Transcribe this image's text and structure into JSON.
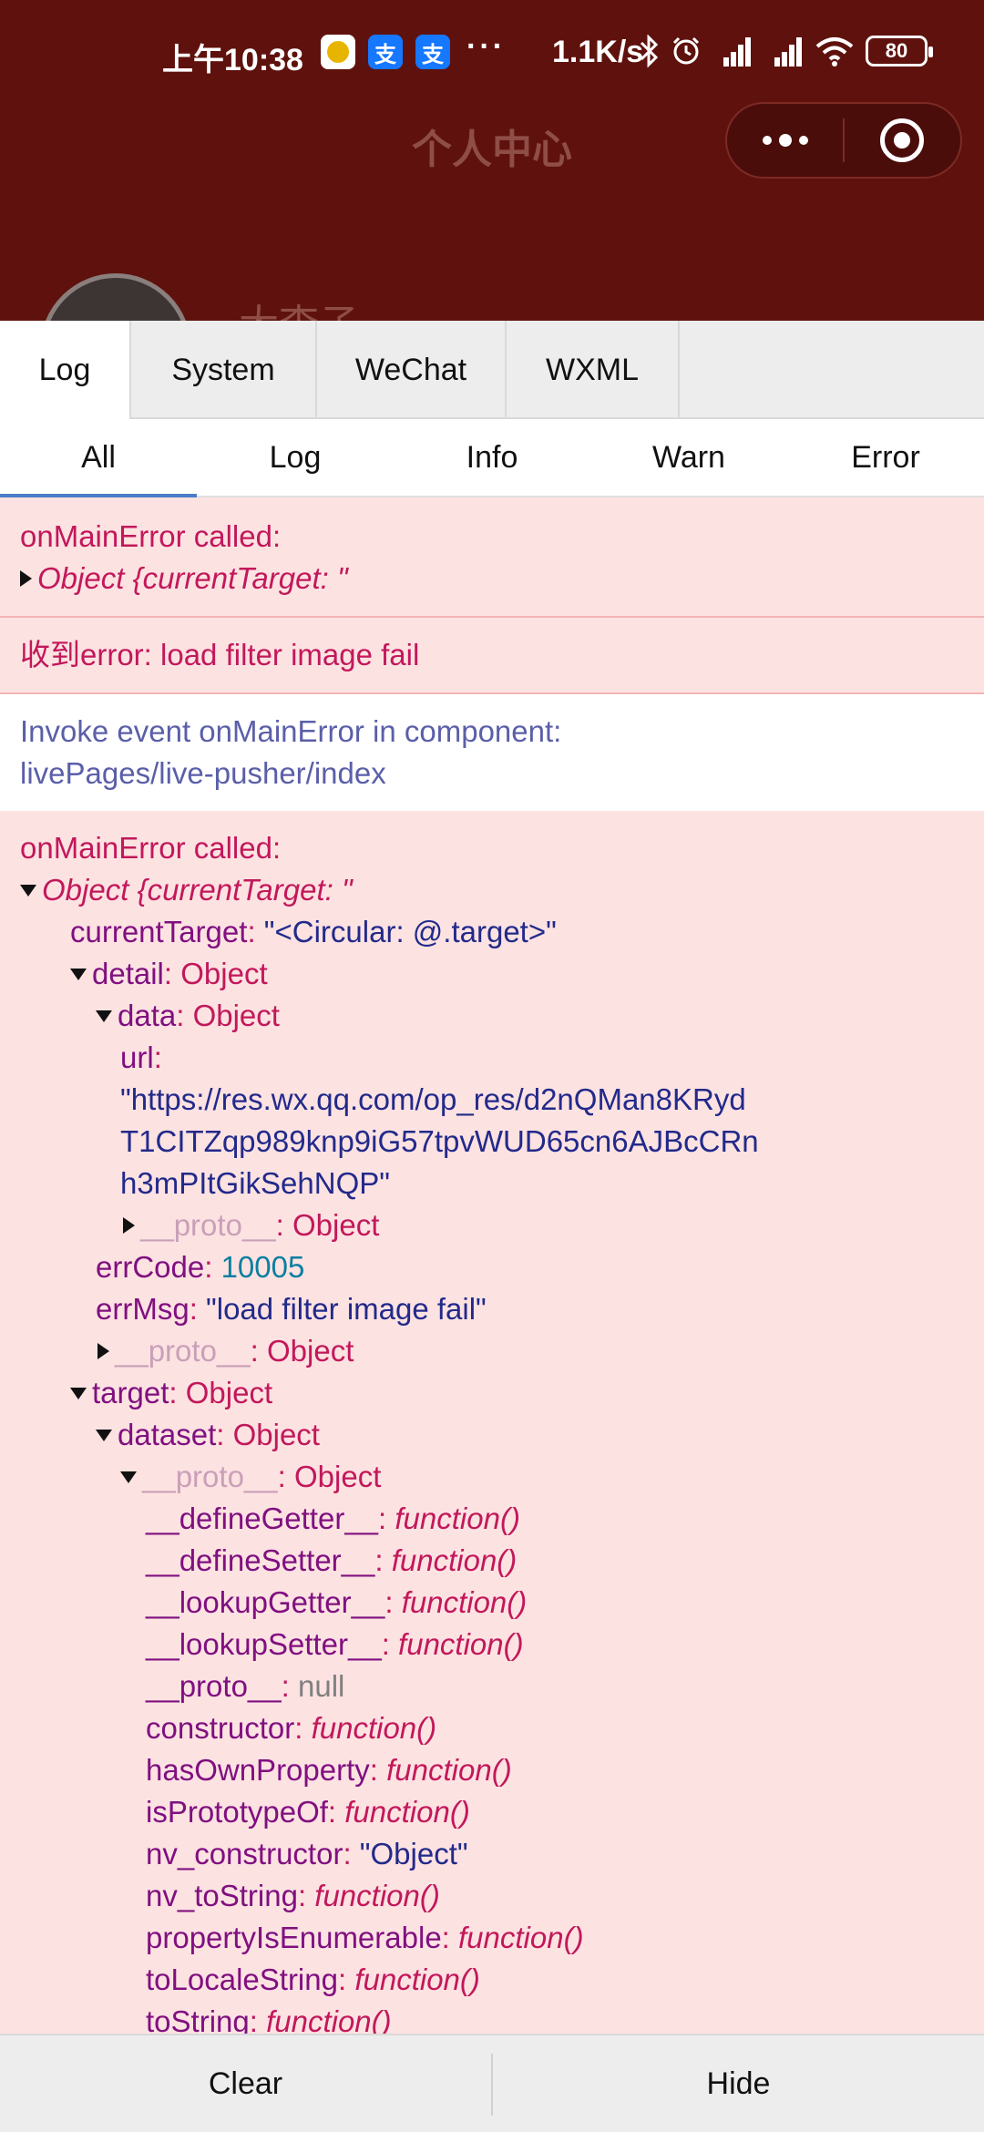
{
  "status_bar": {
    "time": "上午10:38",
    "alipay_glyph": "支",
    "more": "···",
    "net_speed": "1.1K/s",
    "battery": "80",
    "icons": [
      "lemon-app-icon",
      "alipay-icon",
      "alipay-icon",
      "bluetooth-icon",
      "alarm-icon",
      "signal-hd-icon",
      "signal-hd-icon",
      "wifi-icon",
      "battery-icon"
    ]
  },
  "header": {
    "title": "个人中心",
    "user_name": "大李子"
  },
  "console": {
    "main_tabs": [
      "Log",
      "System",
      "WeChat",
      "WXML"
    ],
    "filter_tabs": [
      "All",
      "Log",
      "Info",
      "Warn",
      "Error"
    ],
    "entry1": {
      "line1": "onMainError called:",
      "obj": "Object {currentTarget: \""
    },
    "entry2": {
      "text": "收到error: load filter image fail"
    },
    "entry3": {
      "line1": "Invoke event onMainError in component:",
      "line2": "livePages/live-pusher/index"
    },
    "entry4": {
      "line1": "onMainError called:",
      "obj": "Object {currentTarget: \"",
      "currentTarget_key": "currentTarget",
      "currentTarget_val": "\"<Circular: @.target>\"",
      "detail_key": "detail",
      "data_key": "data",
      "url_key": "url",
      "url_val_1": "\"https://res.wx.qq.com/op_res/d2nQMan8KRyd",
      "url_val_2": "T1CITZqp989knp9iG57tpvWUD65cn6AJBcCRn",
      "url_val_3": "h3mPItGikSehNQP\"",
      "proto_key": "__proto__",
      "object_val": "Object",
      "errCode_key": "errCode",
      "errCode_val": "10005",
      "errMsg_key": "errMsg",
      "errMsg_val": "\"load filter image fail\"",
      "target_key": "target",
      "dataset_key": "dataset",
      "proto_members": [
        {
          "key": "__defineGetter__",
          "val": "function()",
          "type": "fn"
        },
        {
          "key": "__defineSetter__",
          "val": "function()",
          "type": "fn"
        },
        {
          "key": "__lookupGetter__",
          "val": "function()",
          "type": "fn"
        },
        {
          "key": "__lookupSetter__",
          "val": "function()",
          "type": "fn"
        },
        {
          "key": "__proto__",
          "val": "null",
          "type": "null"
        },
        {
          "key": "constructor",
          "val": "function()",
          "type": "fn"
        },
        {
          "key": "hasOwnProperty",
          "val": "function()",
          "type": "fn"
        },
        {
          "key": "isPrototypeOf",
          "val": "function()",
          "type": "fn"
        },
        {
          "key": "nv_constructor",
          "val": "\"Object\"",
          "type": "str"
        },
        {
          "key": "nv_toString",
          "val": "function()",
          "type": "fn"
        },
        {
          "key": "propertyIsEnumerable",
          "val": "function()",
          "type": "fn"
        },
        {
          "key": "toLocaleString",
          "val": "function()",
          "type": "fn"
        },
        {
          "key": "toString",
          "val": "function()",
          "type": "fn"
        }
      ]
    },
    "bottom": {
      "clear": "Clear",
      "hide": "Hide"
    }
  },
  "colors": {
    "header_bg": "#5f120d",
    "error_bg": "#fde2e2",
    "error_text": "#c2185b",
    "info_text": "#5b5fa8",
    "active_tab_indicator": "#4a7cc7"
  }
}
